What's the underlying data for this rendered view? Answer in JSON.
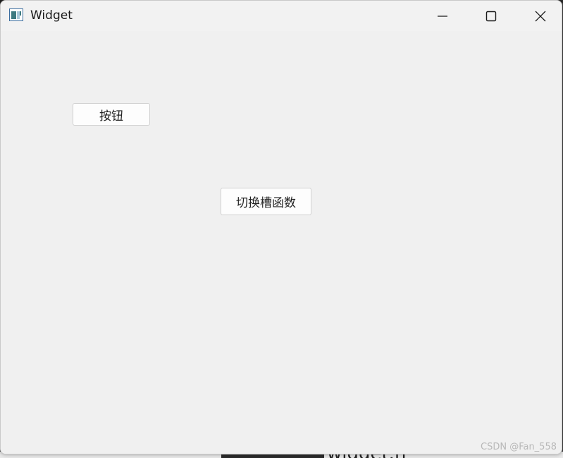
{
  "window": {
    "title": "Widget",
    "icon": "qt-widget-app-icon"
  },
  "caption_buttons": {
    "minimize": "minimize-icon",
    "maximize": "maximize-icon",
    "close": "close-icon"
  },
  "client": {
    "button_1_label": "按钮",
    "button_2_label": "切换槽函数"
  },
  "background": {
    "partial_text": "widget.h"
  },
  "watermark": "CSDN @Fan_558"
}
